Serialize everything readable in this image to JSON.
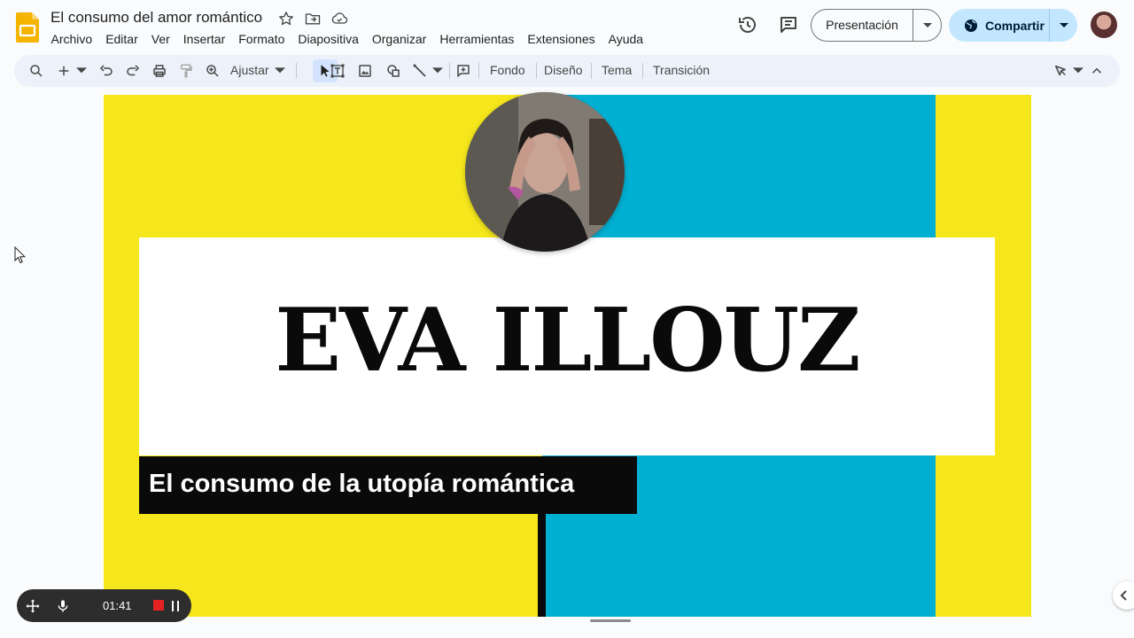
{
  "app": {
    "doc_title": "El consumo del amor romántico",
    "menus": [
      "Archivo",
      "Editar",
      "Ver",
      "Insertar",
      "Formato",
      "Diapositiva",
      "Organizar",
      "Herramientas",
      "Extensiones",
      "Ayuda"
    ],
    "icons": {
      "logo": "slides-logo-icon",
      "star": "star-icon",
      "move": "move-to-folder-icon",
      "cloud": "cloud-saved-icon",
      "history": "history-icon",
      "comments": "comments-icon"
    }
  },
  "header": {
    "present_label": "Presentación",
    "share_label": "Compartir"
  },
  "toolbar": {
    "zoom_label": "Ajustar",
    "background_label": "Fondo",
    "layout_label": "Diseño",
    "theme_label": "Tema",
    "transition_label": "Transición"
  },
  "slide": {
    "title": "EVA ILLOUZ",
    "subtitle": "El consumo de la utopía romántica",
    "colors": {
      "yellow": "#f5e71b",
      "blue": "#00b0d2",
      "white": "#ffffff",
      "black": "#0a0a0a"
    }
  },
  "recorder": {
    "elapsed": "01:41"
  },
  "colors": {
    "accent": "#c2e7ff",
    "toolbar_bg": "#edf2fa",
    "logo_yellow": "#f4b400"
  }
}
